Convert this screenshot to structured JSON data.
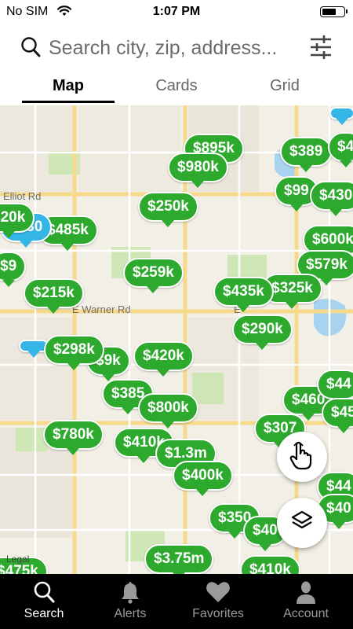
{
  "status_bar": {
    "carrier": "No SIM",
    "time": "1:07 PM",
    "battery_level": 0.58
  },
  "search": {
    "placeholder": "Search city, zip, address..."
  },
  "tabs": [
    {
      "label": "Map",
      "active": true
    },
    {
      "label": "Cards",
      "active": false
    },
    {
      "label": "Grid",
      "active": false
    }
  ],
  "map": {
    "road_labels": [
      "Elliot Rd",
      "E Warner Rd",
      "E"
    ],
    "legal": "Legal",
    "pins": [
      "$895k",
      "$980k",
      "$389",
      "$4",
      "$99",
      "$430",
      "$250k",
      "$485k",
      "$530",
      "$600k",
      "$579k",
      "$259k",
      "$215k",
      "$435k",
      "$325k",
      "$290k",
      "$298k",
      "$420k",
      "$385",
      "$800k",
      "$780k",
      "$410k",
      "$1.3m",
      "$400k",
      "$460",
      "$44",
      "$45",
      "$307",
      "$350",
      "$40",
      "$44",
      "$3.75m",
      "$410k",
      "$475k",
      "$4",
      "$20k",
      "$9k",
      "$9"
    ]
  },
  "nav": [
    {
      "label": "Search",
      "icon": "search-icon",
      "active": true
    },
    {
      "label": "Alerts",
      "icon": "bell-icon",
      "active": false
    },
    {
      "label": "Favorites",
      "icon": "heart-icon",
      "active": false
    },
    {
      "label": "Account",
      "icon": "person-icon",
      "active": false
    }
  ]
}
